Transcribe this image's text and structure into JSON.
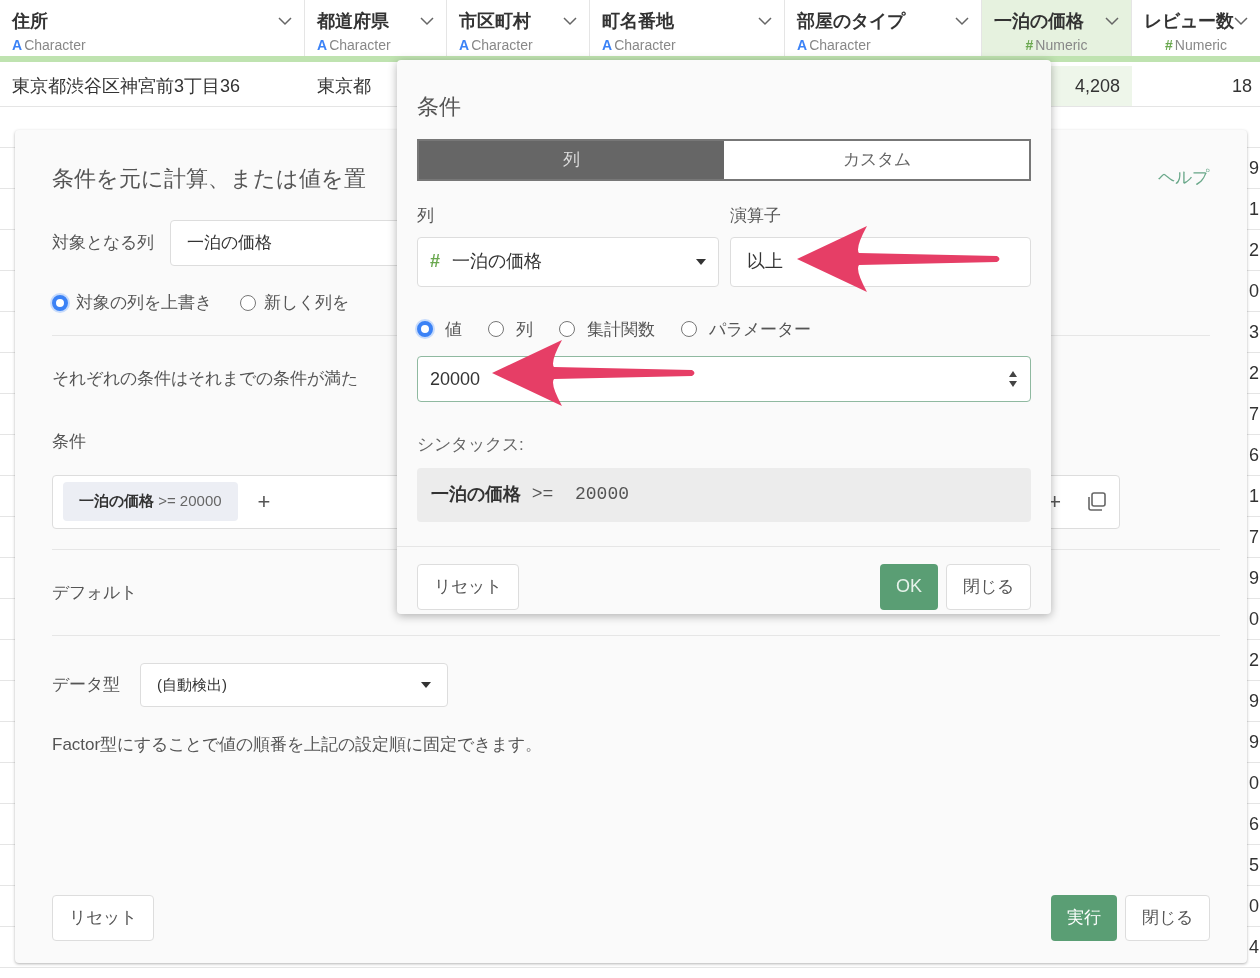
{
  "table": {
    "columns": [
      {
        "name": "住所",
        "type_icon": "A",
        "type": "Character",
        "kind": "character",
        "selected": false
      },
      {
        "name": "都道府県",
        "type_icon": "A",
        "type": "Character",
        "kind": "character",
        "selected": false
      },
      {
        "name": "市区町村",
        "type_icon": "A",
        "type": "Character",
        "kind": "character",
        "selected": false
      },
      {
        "name": "町名番地",
        "type_icon": "A",
        "type": "Character",
        "kind": "character",
        "selected": false
      },
      {
        "name": "部屋のタイプ",
        "type_icon": "A",
        "type": "Character",
        "kind": "character",
        "selected": false
      },
      {
        "name": "一泊の価格",
        "type_icon": "#",
        "type": "Numeric",
        "kind": "numeric",
        "selected": true
      },
      {
        "name": "レビュー数",
        "type_icon": "#",
        "type": "Numeric",
        "kind": "numeric",
        "selected": false
      }
    ],
    "first_row": {
      "address": "東京都渋谷区神宮前3丁目36",
      "prefecture": "東京都",
      "price": "4,208",
      "reviews": "18"
    },
    "review_fragments": [
      "9",
      "1",
      "2",
      "0",
      "3",
      "2",
      "7",
      "6",
      "1",
      "7",
      "9",
      "0",
      "2",
      "9",
      "9",
      "0",
      "6",
      "5",
      "0",
      "4"
    ]
  },
  "dialog": {
    "title": "条件を元に計算、または値を置",
    "help_link": "ヘルプ",
    "target_label": "対象となる列",
    "target_value": "一泊の価格",
    "output_modes": [
      {
        "label": "対象の列を上書き",
        "selected": true
      },
      {
        "label": "新しく列を",
        "selected": false
      }
    ],
    "description": "それぞれの条件はそれまでの条件が満た",
    "conditions_label": "条件",
    "condition_chips": [
      {
        "column": "一泊の価格",
        "expression": ">= 20000"
      }
    ],
    "add_symbol": "+",
    "right_add_symbol": "+",
    "default_label": "デフォルト",
    "data_type_label": "データ型",
    "data_type_value": "(自動検出)",
    "note": "Factor型にすることで値の順番を上記の設定順に固定できます。",
    "reset_button": "リセット",
    "run_button": "実行",
    "close_button": "閉じる"
  },
  "popup": {
    "title": "条件",
    "tabs": [
      {
        "label": "列",
        "selected": true
      },
      {
        "label": "カスタム",
        "selected": false
      }
    ],
    "column_label": "列",
    "column_type_icon": "#",
    "column_value": "一泊の価格",
    "operator_label": "演算子",
    "operator_value": "以上",
    "value_sources": [
      {
        "label": "値",
        "selected": true
      },
      {
        "label": "列",
        "selected": false
      },
      {
        "label": "集計関数",
        "selected": false
      },
      {
        "label": "パラメーター",
        "selected": false
      }
    ],
    "value_input": "20000",
    "syntax_label": "シンタックス:",
    "syntax": {
      "column": "一泊の価格",
      "expression": ">=  20000"
    },
    "reset_button": "リセット",
    "ok_button": "OK",
    "close_button": "閉じる"
  }
}
